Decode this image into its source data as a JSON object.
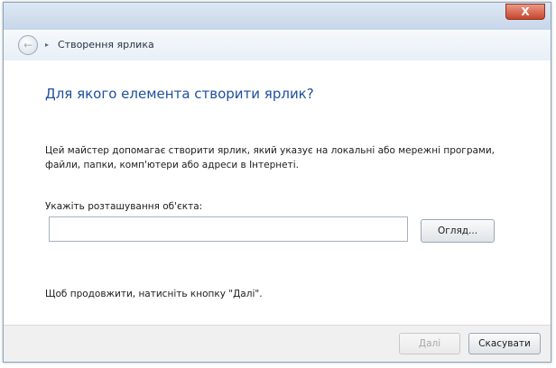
{
  "window": {
    "close_glyph": "X",
    "accent_color": "#1f4fa0"
  },
  "nav": {
    "back_icon": "back-arrow-icon",
    "back_glyph": "←",
    "crumb_arrow": "▸",
    "title": "Створення ярлика"
  },
  "main": {
    "heading": "Для якого елемента створити ярлик?",
    "description": "Цей майстер допомагає створити ярлик, який указує на локальні або мережні програми, файли, папки, комп'ютери або адреси в Інтернеті.",
    "location_label": "Укажіть розташування об'єкта:",
    "location_value": "",
    "browse_label": "Огляд...",
    "continue_hint": "Щоб продовжити, натисніть кнопку \"Далі\"."
  },
  "footer": {
    "next_label": "Далі",
    "cancel_label": "Скасувати"
  }
}
